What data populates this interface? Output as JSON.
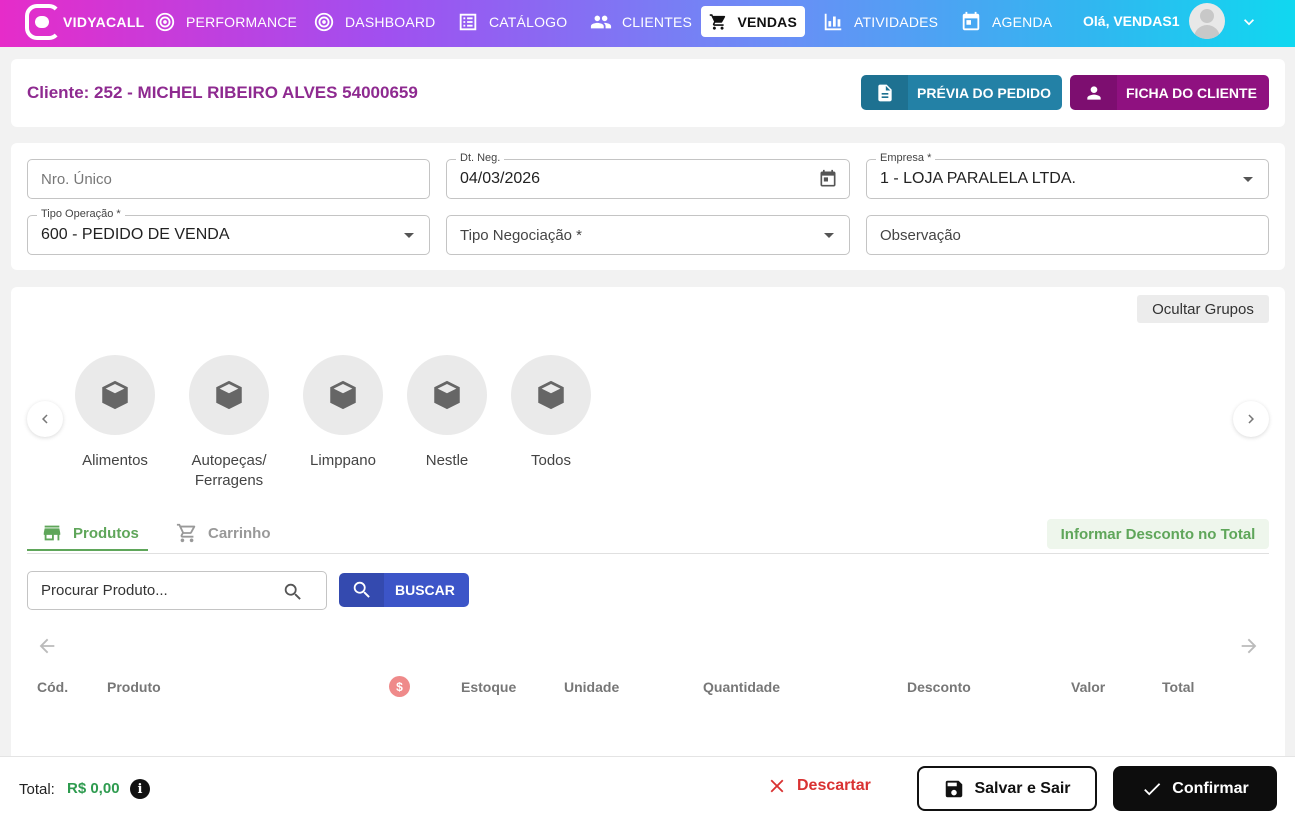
{
  "nav": {
    "logo_text": "VIDYACALL",
    "items": [
      {
        "label": "PERFORMANCE",
        "icon": "target-icon"
      },
      {
        "label": "DASHBOARD",
        "icon": "target-icon"
      },
      {
        "label": "CATÁLOGO",
        "icon": "list-icon"
      },
      {
        "label": "CLIENTES",
        "icon": "people-icon"
      },
      {
        "label": "VENDAS",
        "icon": "cart-icon",
        "active": true
      },
      {
        "label": "ATIVIDADES",
        "icon": "bar-chart-icon"
      },
      {
        "label": "AGENDA",
        "icon": "calendar-icon"
      }
    ],
    "greeting": "Olá, VENDAS1"
  },
  "header": {
    "client_title": "Cliente: 252 - MICHEL RIBEIRO ALVES 54000659",
    "preview_button": "PRÉVIA DO PEDIDO",
    "client_sheet_button": "FICHA DO CLIENTE"
  },
  "form": {
    "nro_unico_placeholder": "Nro. Único",
    "dt_neg_label": "Dt. Neg.",
    "dt_neg_value": "04/03/2026",
    "empresa_label": "Empresa *",
    "empresa_value": "1 - LOJA PARALELA LTDA.",
    "tipo_operacao_label": "Tipo Operação *",
    "tipo_operacao_value": "600 - PEDIDO DE VENDA",
    "tipo_negociacao_placeholder": "Tipo Negociação *",
    "observacao_placeholder": "Observação"
  },
  "groups": {
    "hide_button": "Ocultar Grupos",
    "items": [
      {
        "name_line1": "Alimentos",
        "name_line2": ""
      },
      {
        "name_line1": "Autopeças/",
        "name_line2": "Ferragens"
      },
      {
        "name_line1": "Limppano",
        "name_line2": ""
      },
      {
        "name_line1": "Nestle",
        "name_line2": ""
      },
      {
        "name_line1": "Todos",
        "name_line2": ""
      }
    ]
  },
  "tabs": {
    "produtos": "Produtos",
    "carrinho": "Carrinho",
    "discount_total": "Informar Desconto no Total"
  },
  "search": {
    "placeholder": "Procurar Produto...",
    "button": "BUSCAR"
  },
  "table": {
    "headers": [
      "Cód.",
      "Produto",
      "$",
      "Estoque",
      "Unidade",
      "Quantidade",
      "Desconto",
      "Valor",
      "Total"
    ]
  },
  "footer": {
    "total_label": "Total:",
    "total_value": "R$ 0,00",
    "discard": "Descartar",
    "save_exit": "Salvar e Sair",
    "confirm": "Confirmar"
  },
  "colors": {
    "client_title": "#8e2a90",
    "preview_btn": "#2381a6",
    "ficha_btn": "#8f1180",
    "accent_green": "#5fa65a",
    "buscar_btn": "#3c55c8",
    "discard_red": "#d93232"
  }
}
